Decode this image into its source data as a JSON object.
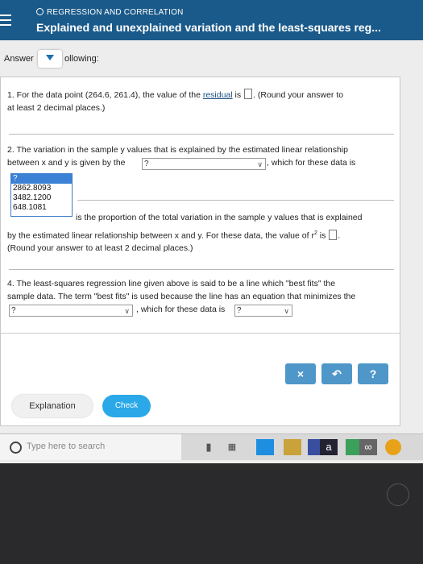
{
  "header": {
    "subtitle": "REGRESSION AND CORRELATION",
    "title": "Explained and unexplained variation and the least-squares reg..."
  },
  "answer_bar": {
    "label": "Answer",
    "text_after": "ollowing:"
  },
  "q1": {
    "text_a": "1. For the data point (264.6, 261.4), the value of the ",
    "link": "residual",
    "text_b": " is",
    "text_c": ". (Round your answer to",
    "line2": "at least 2 decimal places.)"
  },
  "q2": {
    "line1": "2. The variation in the sample y values that is explained by the estimated linear relationship",
    "line2_a": "between x and y is given by the",
    "select_value": "?",
    "line2_b": ", which for these data is",
    "dropdown_options": [
      "?",
      "2862.8093",
      "3482.1200",
      "648.1081"
    ]
  },
  "q3": {
    "line1_b": "is the proportion of the total variation in the sample y values that is explained",
    "line2": "by the estimated linear relationship between x and y. For these data, the value of r",
    "sup": "2",
    "line2_end": " is",
    "line3": "(Round your answer to at least 2 decimal places.)"
  },
  "q4": {
    "line1": "4. The least-squares regression line given above is said to be a line which \"best fits\" the",
    "line2": "sample data. The term \"best fits\" is used because the line has an equation that minimizes the",
    "select1": "?",
    "mid": ", which for these data is",
    "select2": "?"
  },
  "toolbar": {
    "close": "×",
    "undo": "↶",
    "help": "?"
  },
  "buttons": {
    "explanation": "Explanation",
    "check": "Check"
  },
  "taskbar": {
    "search_placeholder": "Type here to search"
  },
  "colors": {
    "header": "#1a5a8a",
    "accent": "#2aa8e8",
    "toolbar_button": "#4f97c9"
  }
}
